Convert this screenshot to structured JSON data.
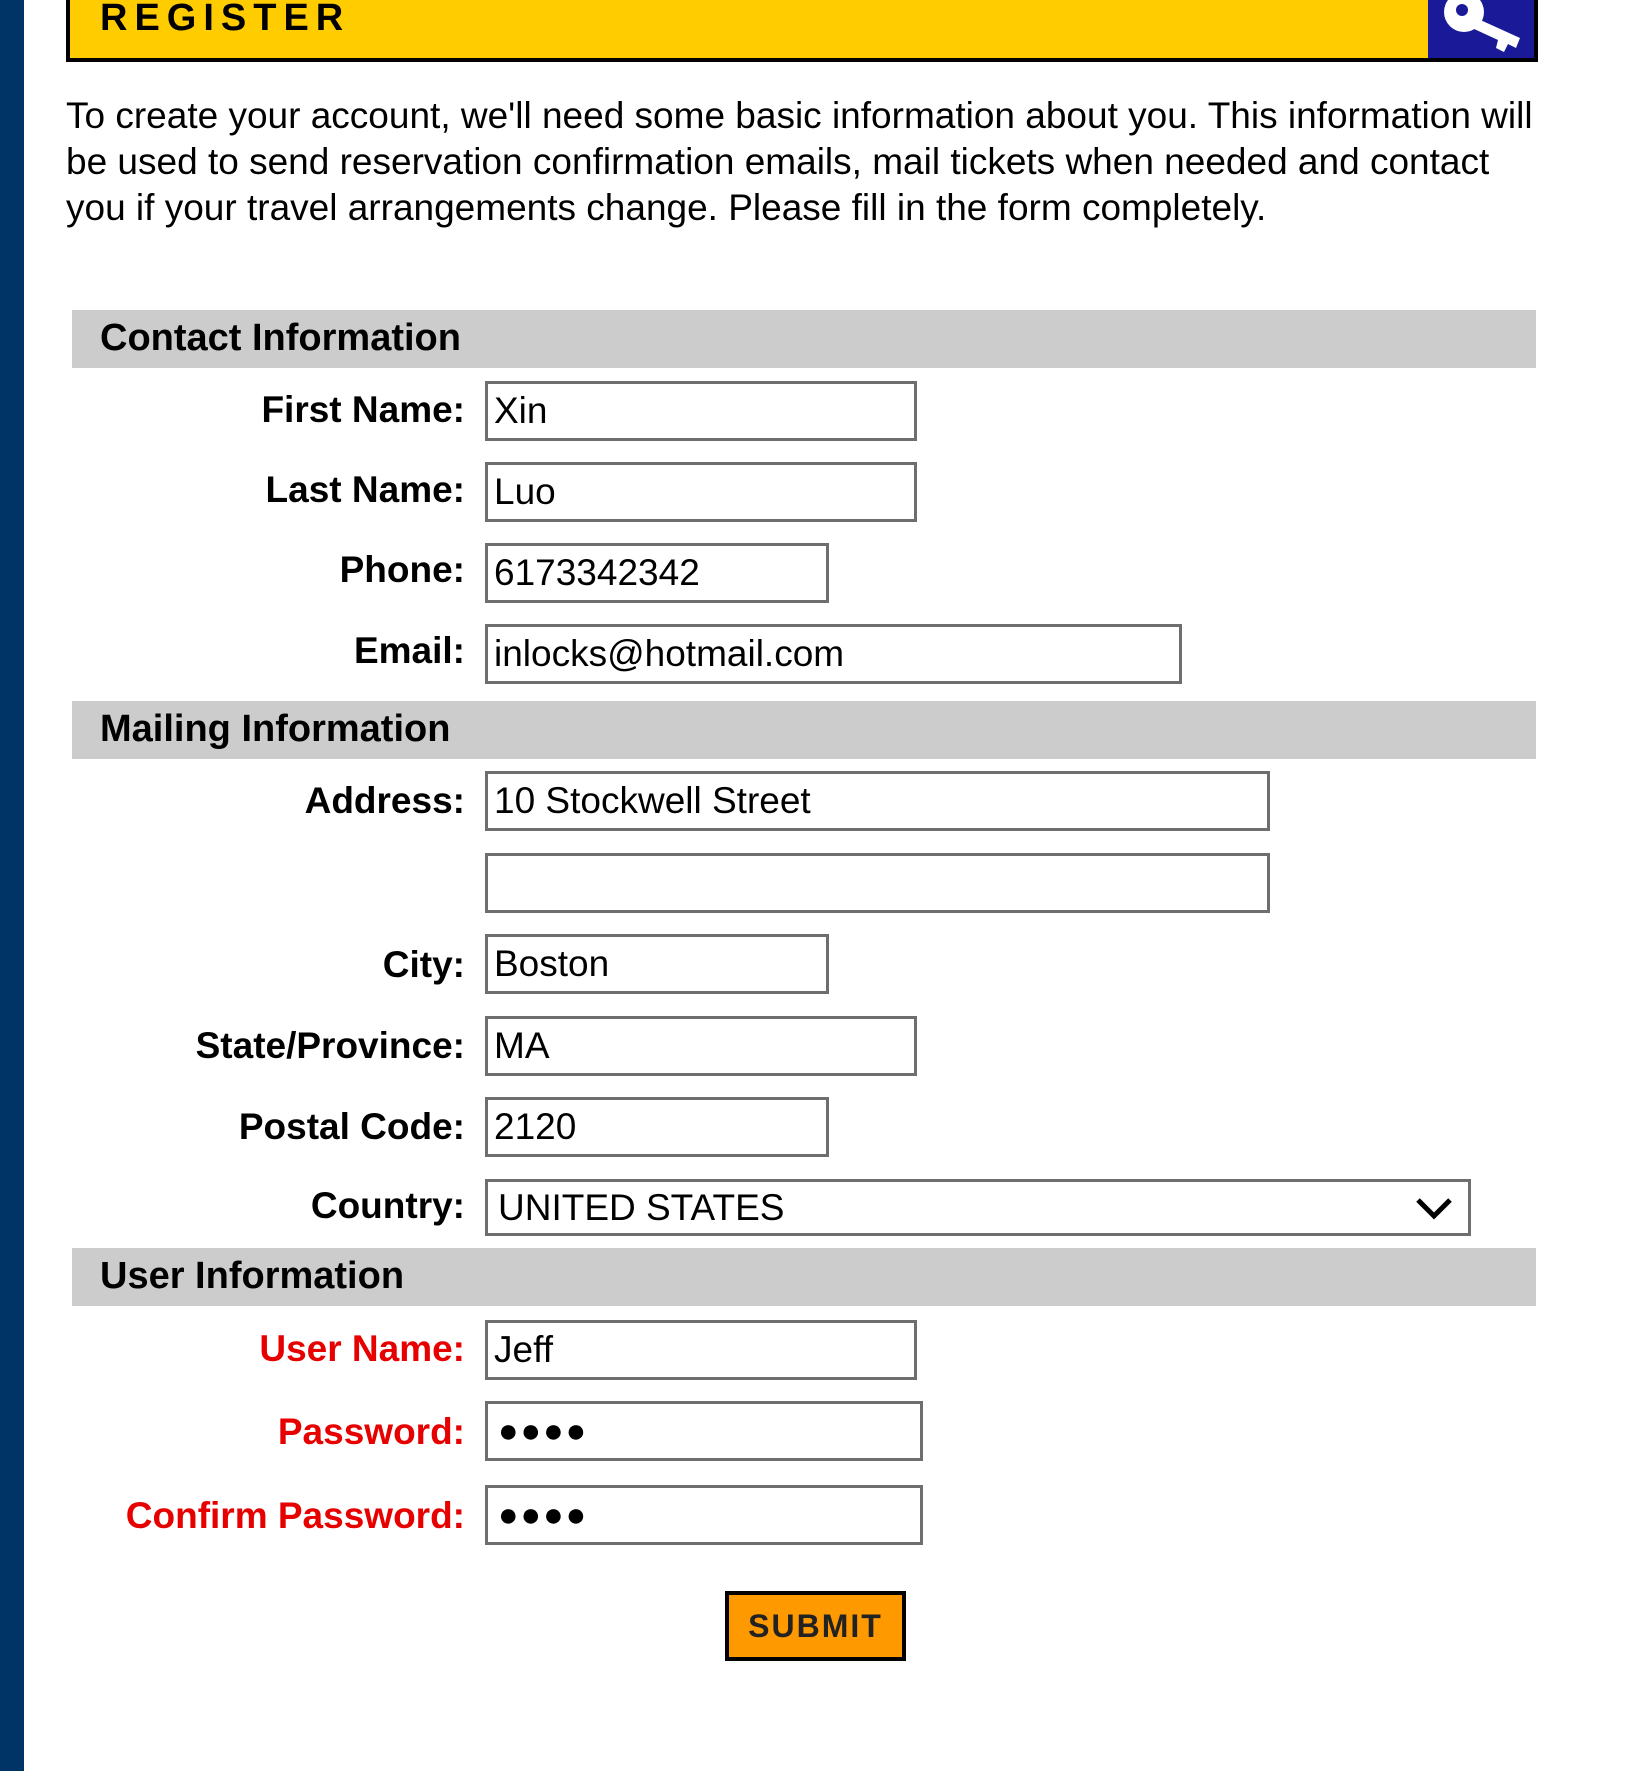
{
  "banner": {
    "title": "REGISTER",
    "icon": "key-icon"
  },
  "intro": "To create your account, we'll need some basic information about you. This information will be used to send reservation confirmation emails, mail tickets when needed and contact you if your travel arrangements change. Please fill in the form completely.",
  "contact": {
    "header": "Contact Information",
    "first_name": {
      "label": "First Name:",
      "value": "Xin"
    },
    "last_name": {
      "label": "Last Name:",
      "value": "Luo"
    },
    "phone": {
      "label": "Phone:",
      "value": "6173342342"
    },
    "email": {
      "label": "Email:",
      "value": "inlocks@hotmail.com"
    }
  },
  "mailing": {
    "header": "Mailing Information",
    "address": {
      "label": "Address:",
      "value": "10 Stockwell Street",
      "value2": ""
    },
    "city": {
      "label": "City:",
      "value": "Boston"
    },
    "state": {
      "label": "State/Province:",
      "value": "MA"
    },
    "postal": {
      "label": "Postal Code:",
      "value": "2120"
    },
    "country": {
      "label": "Country:",
      "value": "UNITED STATES"
    }
  },
  "user": {
    "header": "User Information",
    "username": {
      "label": "User Name:",
      "value": "Jeff"
    },
    "password": {
      "label": "Password:",
      "masked": "●●●●"
    },
    "confirm": {
      "label": "Confirm Password:",
      "masked": "●●●●"
    }
  },
  "submit_label": "SUBMIT",
  "colors": {
    "banner": "#ffcc00",
    "sidebar": "#003366",
    "required": "#e60000",
    "submit": "#ff9900",
    "section": "#cccccc"
  }
}
